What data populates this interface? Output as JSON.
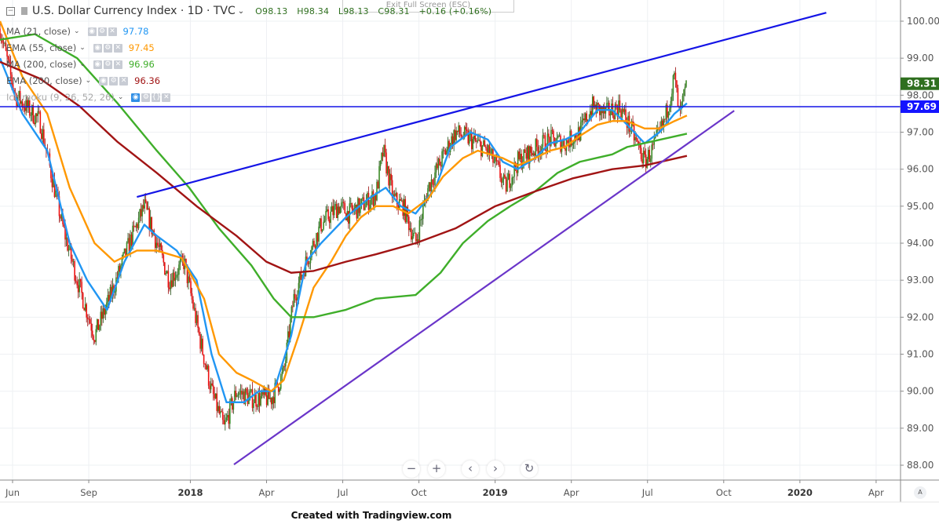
{
  "header": {
    "title": "U.S. Dollar Currency Index · 1D · TVC",
    "open": "O98.13",
    "high": "H98.34",
    "low": "L98.13",
    "close": "C98.31",
    "change": "+0.16 (+0.16%)",
    "exit_fullscreen": "Exit Full Screen (ESC)"
  },
  "indicators": [
    {
      "label": "MA (21, close)",
      "value": "97.78",
      "color": "#2196f3"
    },
    {
      "label": "EMA (55, close)",
      "value": "97.45",
      "color": "#ff9800"
    },
    {
      "label": "MA (200, close)",
      "value": "96.96",
      "color": "#3fae2a"
    },
    {
      "label": "EMA (200, close)",
      "value": "96.36",
      "color": "#a11414"
    },
    {
      "label": "Ichimoku (9, 26, 52, 26)",
      "value": "",
      "color": "#999999"
    }
  ],
  "controls": {
    "zoom_out": "−",
    "zoom_in": "+",
    "prev": "‹",
    "next": "›",
    "reset": "↻",
    "auto": "A"
  },
  "footer": "Created with Tradingview.com",
  "chart_data": {
    "type": "candlestick",
    "title": "U.S. Dollar Currency Index · 1D · TVC",
    "x_unit": "months since Jun 2017",
    "ylim": [
      87.7,
      100.5
    ],
    "yticks": [
      "100.00",
      "99.00",
      "98.00",
      "97.00",
      "96.00",
      "95.00",
      "94.00",
      "93.00",
      "92.00",
      "91.00",
      "90.00",
      "89.00",
      "88.00"
    ],
    "xticks": [
      {
        "label": "Jun",
        "m": 0,
        "bold": false
      },
      {
        "label": "Sep",
        "m": 3,
        "bold": false
      },
      {
        "label": "2018",
        "m": 7,
        "bold": true
      },
      {
        "label": "Apr",
        "m": 10,
        "bold": false
      },
      {
        "label": "Jul",
        "m": 13,
        "bold": false
      },
      {
        "label": "Oct",
        "m": 16,
        "bold": false
      },
      {
        "label": "2019",
        "m": 19,
        "bold": true
      },
      {
        "label": "Apr",
        "m": 22,
        "bold": false
      },
      {
        "label": "Jul",
        "m": 25,
        "bold": false
      },
      {
        "label": "Oct",
        "m": 28,
        "bold": false
      },
      {
        "label": "2020",
        "m": 31,
        "bold": true
      },
      {
        "label": "Apr",
        "m": 34,
        "bold": false
      }
    ],
    "price_close_path": [
      [
        -0.5,
        99.8
      ],
      [
        0.1,
        98
      ],
      [
        1.1,
        97.3
      ],
      [
        2.0,
        94.5
      ],
      [
        2.6,
        93
      ],
      [
        3.3,
        91.5
      ],
      [
        3.9,
        92.5
      ],
      [
        4.7,
        94
      ],
      [
        5.3,
        95
      ],
      [
        5.8,
        94
      ],
      [
        6.3,
        93
      ],
      [
        6.9,
        93.5
      ],
      [
        7.5,
        91.5
      ],
      [
        8.0,
        90
      ],
      [
        8.5,
        89
      ],
      [
        9.0,
        90
      ],
      [
        9.6,
        89.8
      ],
      [
        10.4,
        89.8
      ],
      [
        10.9,
        90.5
      ],
      [
        11.3,
        92.5
      ],
      [
        11.8,
        93.5
      ],
      [
        12.4,
        94.5
      ],
      [
        13.1,
        95
      ],
      [
        13.5,
        94.8
      ],
      [
        14.0,
        95
      ],
      [
        14.6,
        95.3
      ],
      [
        14.9,
        96.5
      ],
      [
        15.3,
        95.2
      ],
      [
        15.7,
        95
      ],
      [
        16.2,
        94
      ],
      [
        16.7,
        95.5
      ],
      [
        17.2,
        96.2
      ],
      [
        17.8,
        97
      ],
      [
        18.4,
        96.8
      ],
      [
        19.1,
        96.5
      ],
      [
        19.5,
        96
      ],
      [
        19.8,
        95.5
      ],
      [
        20.3,
        96.2
      ],
      [
        20.9,
        96.5
      ],
      [
        21.6,
        96.8
      ],
      [
        22.2,
        96.7
      ],
      [
        22.8,
        97
      ],
      [
        23.3,
        97.7
      ],
      [
        23.8,
        97.5
      ],
      [
        24.4,
        97.7
      ],
      [
        24.9,
        97
      ],
      [
        25.4,
        96.2
      ],
      [
        25.7,
        96.5
      ],
      [
        26.2,
        97.3
      ],
      [
        26.6,
        98.5
      ],
      [
        26.8,
        97.4
      ],
      [
        27.1,
        98.31
      ]
    ],
    "series": [
      {
        "name": "MA (21, close)",
        "color": "#2196f3",
        "points": [
          [
            -0.5,
            99
          ],
          [
            0.4,
            97.5
          ],
          [
            1.4,
            96.5
          ],
          [
            2.3,
            94
          ],
          [
            3.0,
            93
          ],
          [
            3.8,
            92.2
          ],
          [
            4.5,
            93.5
          ],
          [
            5.3,
            94.5
          ],
          [
            5.8,
            94.2
          ],
          [
            6.6,
            93.8
          ],
          [
            7.4,
            93
          ],
          [
            8.0,
            91
          ],
          [
            8.6,
            89.7
          ],
          [
            9.3,
            89.7
          ],
          [
            9.9,
            90
          ],
          [
            10.5,
            90
          ],
          [
            11.2,
            91.5
          ],
          [
            11.8,
            93.5
          ],
          [
            12.4,
            94
          ],
          [
            13.4,
            94.7
          ],
          [
            14.3,
            95.2
          ],
          [
            15.0,
            95.5
          ],
          [
            15.6,
            95
          ],
          [
            16.2,
            94.8
          ],
          [
            17.0,
            95.5
          ],
          [
            17.6,
            96.6
          ],
          [
            18.4,
            97
          ],
          [
            19.1,
            96.8
          ],
          [
            19.7,
            96.2
          ],
          [
            20.3,
            96
          ],
          [
            21.0,
            96.3
          ],
          [
            21.6,
            96.7
          ],
          [
            22.2,
            96.8
          ],
          [
            22.8,
            97
          ],
          [
            23.5,
            97.6
          ],
          [
            24.1,
            97.6
          ],
          [
            24.7,
            97.2
          ],
          [
            25.4,
            96.7
          ],
          [
            26.0,
            97
          ],
          [
            26.6,
            97.5
          ],
          [
            27.1,
            97.78
          ]
        ]
      },
      {
        "name": "EMA (55, close)",
        "color": "#ff9800",
        "points": [
          [
            -0.5,
            100
          ],
          [
            0.4,
            98.5
          ],
          [
            1.4,
            97.5
          ],
          [
            2.3,
            95.5
          ],
          [
            3.3,
            94
          ],
          [
            4.1,
            93.5
          ],
          [
            5.0,
            93.8
          ],
          [
            5.8,
            93.8
          ],
          [
            6.8,
            93.6
          ],
          [
            7.7,
            92.5
          ],
          [
            8.3,
            91
          ],
          [
            9.0,
            90.5
          ],
          [
            9.6,
            90.3
          ],
          [
            10.4,
            90
          ],
          [
            10.9,
            90.3
          ],
          [
            11.5,
            91.5
          ],
          [
            12.1,
            92.8
          ],
          [
            12.8,
            93.5
          ],
          [
            13.4,
            94.2
          ],
          [
            14.0,
            94.7
          ],
          [
            14.6,
            95
          ],
          [
            15.3,
            95
          ],
          [
            15.9,
            94.8
          ],
          [
            16.7,
            95.2
          ],
          [
            17.3,
            95.8
          ],
          [
            18.1,
            96.3
          ],
          [
            18.7,
            96.5
          ],
          [
            19.7,
            96.3
          ],
          [
            20.3,
            96.1
          ],
          [
            21.0,
            96.3
          ],
          [
            21.6,
            96.5
          ],
          [
            22.2,
            96.6
          ],
          [
            22.8,
            96.9
          ],
          [
            23.5,
            97.2
          ],
          [
            24.1,
            97.3
          ],
          [
            24.7,
            97.3
          ],
          [
            25.4,
            97.1
          ],
          [
            26.0,
            97.1
          ],
          [
            26.6,
            97.3
          ],
          [
            27.1,
            97.45
          ]
        ]
      },
      {
        "name": "MA (200, close)",
        "color": "#3fae2a",
        "points": [
          [
            -0.5,
            99.5
          ],
          [
            0.9,
            99.65
          ],
          [
            2.6,
            99
          ],
          [
            4.2,
            97.8
          ],
          [
            5.8,
            96.5
          ],
          [
            7.1,
            95.5
          ],
          [
            8.3,
            94.4
          ],
          [
            9.6,
            93.4
          ],
          [
            10.5,
            92.5
          ],
          [
            11.2,
            92
          ],
          [
            12.1,
            92
          ],
          [
            13.4,
            92.2
          ],
          [
            14.6,
            92.5
          ],
          [
            16.2,
            92.6
          ],
          [
            17.2,
            93.2
          ],
          [
            18.1,
            94
          ],
          [
            19.1,
            94.6
          ],
          [
            20.0,
            95
          ],
          [
            21.0,
            95.4
          ],
          [
            21.9,
            95.9
          ],
          [
            22.8,
            96.2
          ],
          [
            24.1,
            96.4
          ],
          [
            24.7,
            96.6
          ],
          [
            25.7,
            96.75
          ],
          [
            27.1,
            96.96
          ]
        ]
      },
      {
        "name": "EMA (200, close)",
        "color": "#a11414",
        "points": [
          [
            -0.5,
            98.9
          ],
          [
            1.1,
            98.45
          ],
          [
            2.7,
            97.7
          ],
          [
            4.2,
            96.75
          ],
          [
            5.8,
            95.9
          ],
          [
            7.4,
            95
          ],
          [
            9.0,
            94.2
          ],
          [
            10.2,
            93.5
          ],
          [
            11.2,
            93.2
          ],
          [
            12.1,
            93.25
          ],
          [
            13.4,
            93.5
          ],
          [
            14.6,
            93.7
          ],
          [
            16.2,
            94
          ],
          [
            17.8,
            94.4
          ],
          [
            19.4,
            95
          ],
          [
            21.0,
            95.4
          ],
          [
            22.5,
            95.75
          ],
          [
            24.1,
            96
          ],
          [
            25.4,
            96.1
          ],
          [
            27.1,
            96.36
          ]
        ]
      }
    ],
    "trendlines": [
      {
        "name": "upper-resistance-line",
        "color": "#1414e6",
        "from": [
          5.0,
          95.25
        ],
        "to": [
          32.7,
          100.23
        ]
      },
      {
        "name": "horizontal-level-line",
        "color": "#1414e6",
        "level": 97.69
      },
      {
        "name": "rising-support-line",
        "color": "#6a35c9",
        "from": [
          8.9,
          88.02
        ],
        "to": [
          29.0,
          97.58
        ]
      }
    ],
    "last_price": {
      "value": "98.31",
      "color": "#2f6f1f"
    },
    "level_label": {
      "value": "97.69",
      "color": "#1414ff"
    },
    "candle_colors": {
      "up": "#3c8a26",
      "down": "#ee1111"
    }
  }
}
